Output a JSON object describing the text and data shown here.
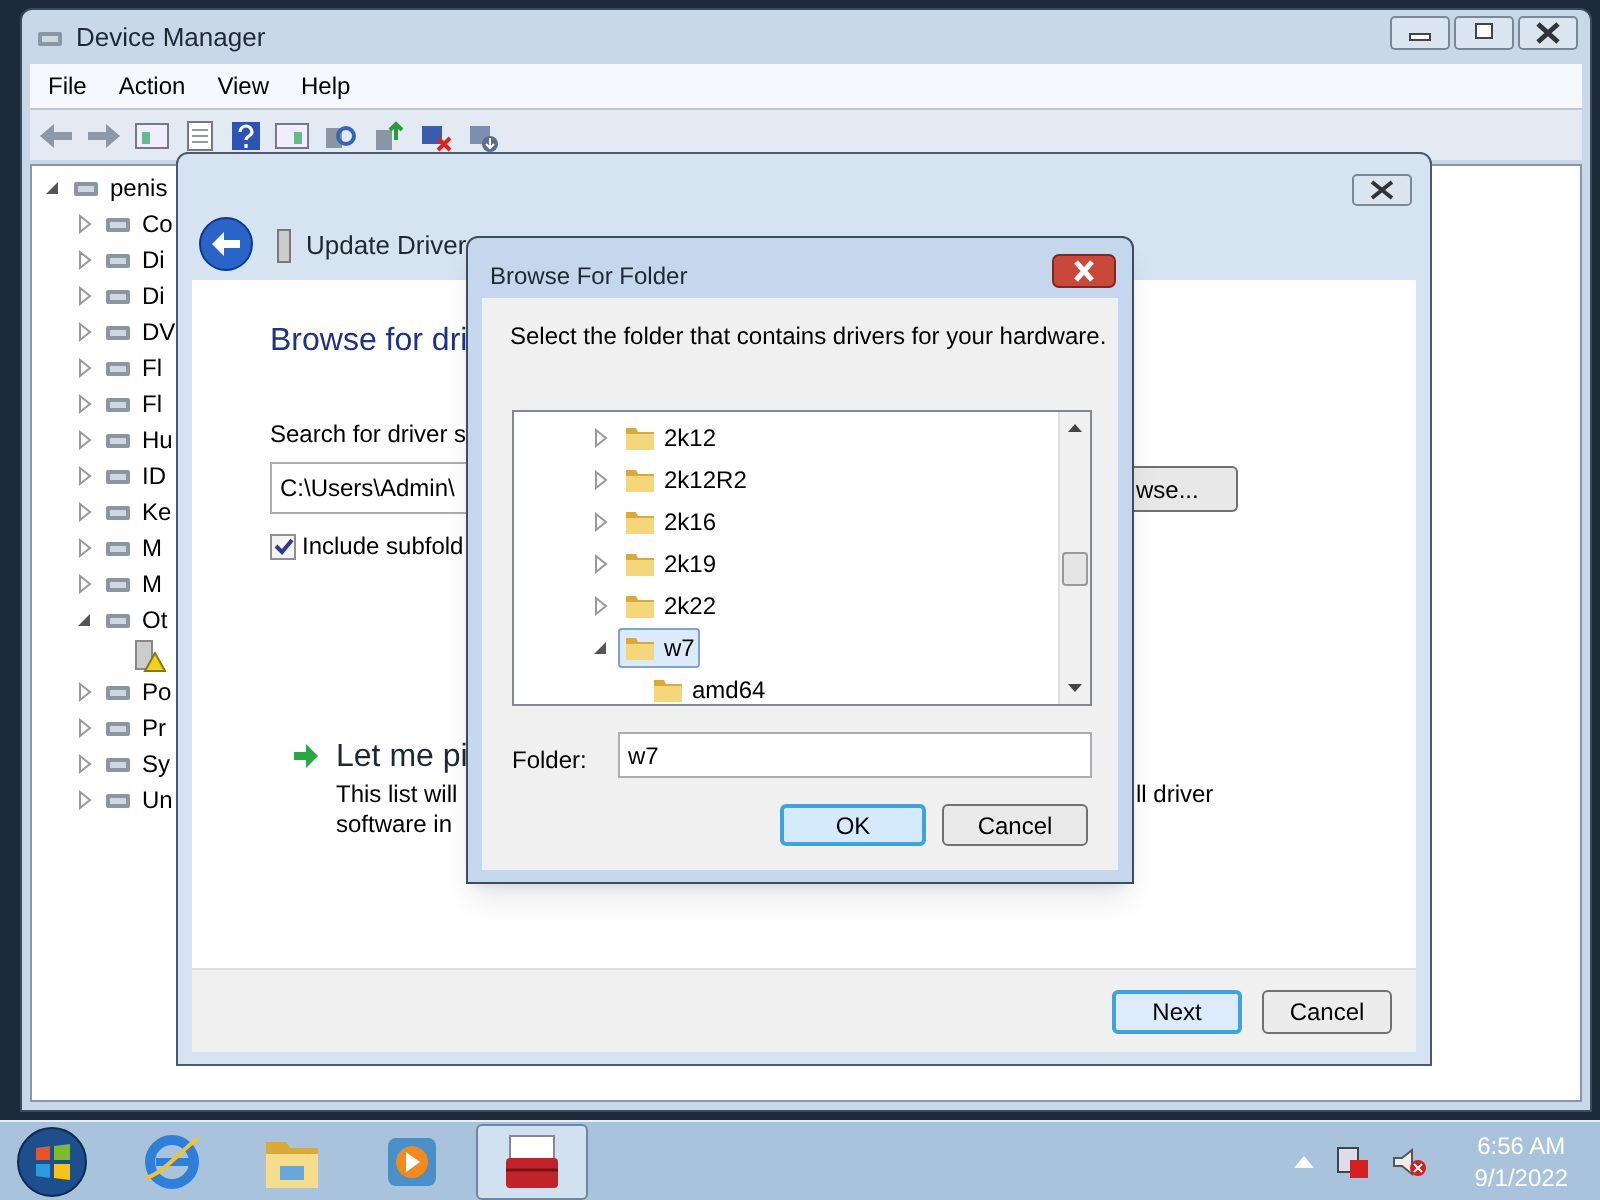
{
  "device_manager": {
    "title": "Device Manager",
    "menu": [
      "File",
      "Action",
      "View",
      "Help"
    ],
    "tree": {
      "label": "penis",
      "expanded": true,
      "children": [
        {
          "label": "Co",
          "expanded": false
        },
        {
          "label": "Di",
          "expanded": false
        },
        {
          "label": "Di",
          "expanded": false
        },
        {
          "label": "DV",
          "expanded": false
        },
        {
          "label": "Fl",
          "expanded": false
        },
        {
          "label": "Fl",
          "expanded": false
        },
        {
          "label": "Hu",
          "expanded": false
        },
        {
          "label": "ID",
          "expanded": false
        },
        {
          "label": "Ke",
          "expanded": false
        },
        {
          "label": "M",
          "expanded": false
        },
        {
          "label": "M",
          "expanded": false
        },
        {
          "label": "Ot",
          "expanded": true,
          "children": [
            {
              "kind": "warning"
            }
          ]
        },
        {
          "label": "Po",
          "expanded": false
        },
        {
          "label": "Pr",
          "expanded": false
        },
        {
          "label": "Sy",
          "expanded": false
        },
        {
          "label": "Un",
          "expanded": false
        }
      ]
    }
  },
  "update_driver": {
    "title": "Update Driver",
    "heading": "Browse for dri",
    "search_label": "Search for driver s",
    "path": "C:\\Users\\Admin\\",
    "browse_button": "wse...",
    "include_subfolders": {
      "label": "Include subfold",
      "checked": true
    },
    "pick_option": {
      "title": "Let me pi",
      "lines": [
        "This list will",
        "software in"
      ],
      "right_fragment": "ll driver"
    },
    "buttons": [
      {
        "label": "Next",
        "focused": true
      },
      {
        "label": "Cancel",
        "focused": false
      }
    ]
  },
  "browse_folder": {
    "title": "Browse For Folder",
    "instruction": "Select the folder that contains drivers for your hardware.",
    "folders": [
      {
        "label": "2k12",
        "expanded": false,
        "selected": false
      },
      {
        "label": "2k12R2",
        "expanded": false,
        "selected": false
      },
      {
        "label": "2k16",
        "expanded": false,
        "selected": false
      },
      {
        "label": "2k19",
        "expanded": false,
        "selected": false
      },
      {
        "label": "2k22",
        "expanded": false,
        "selected": false
      },
      {
        "label": "w7",
        "expanded": true,
        "selected": true,
        "children": [
          {
            "label": "amd64",
            "selected": false
          }
        ]
      }
    ],
    "folder_label": "Folder:",
    "folder_value": "w7",
    "buttons": [
      {
        "label": "OK",
        "focused": true
      },
      {
        "label": "Cancel",
        "focused": false
      }
    ]
  },
  "taskbar": {
    "apps": [
      {
        "kind": "browser",
        "selected": false
      },
      {
        "kind": "folders",
        "selected": false
      },
      {
        "kind": "media",
        "selected": false
      },
      {
        "kind": "toolbox",
        "selected": true
      }
    ],
    "clock": {
      "time": "6:56 AM",
      "date": "9/1/2022"
    }
  }
}
